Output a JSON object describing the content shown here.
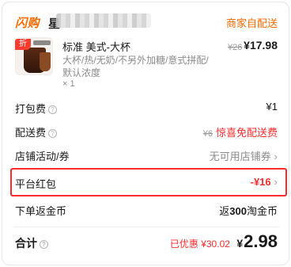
{
  "header": {
    "brand": "闪购",
    "store_name": "星",
    "pickup": "商家自配送"
  },
  "product": {
    "badge": "折",
    "name": "标准 美式-大杯",
    "spec": "大杯/热/无奶/不另外加糖/意式拼配/默认浓度",
    "qty": "× 1",
    "original_price": "¥26",
    "price": "¥17.98"
  },
  "rows": {
    "packing": {
      "label": "打包费",
      "value": "¥1"
    },
    "delivery": {
      "label": "配送费",
      "old": "¥6",
      "value": "惊喜免配送费"
    },
    "store_promo": {
      "label": "店铺活动/券",
      "value": "无可用店铺券"
    },
    "platform_redpacket": {
      "label": "平台红包",
      "value": "-¥16"
    },
    "cashback": {
      "label": "下单返金币",
      "value_prefix": "返",
      "value_num": "300",
      "value_suffix": "淘金币"
    }
  },
  "total": {
    "label": "合计",
    "saved": "已优惠 ¥30.02",
    "currency": "¥",
    "amount": "2.98"
  },
  "colors": {
    "accent_orange": "#ff6a00",
    "accent_red": "#ff2d2d",
    "highlight_border": "#ff2a2a"
  },
  "icons": {
    "help": "question-circle-icon",
    "arrow": "chevron-right-icon"
  }
}
